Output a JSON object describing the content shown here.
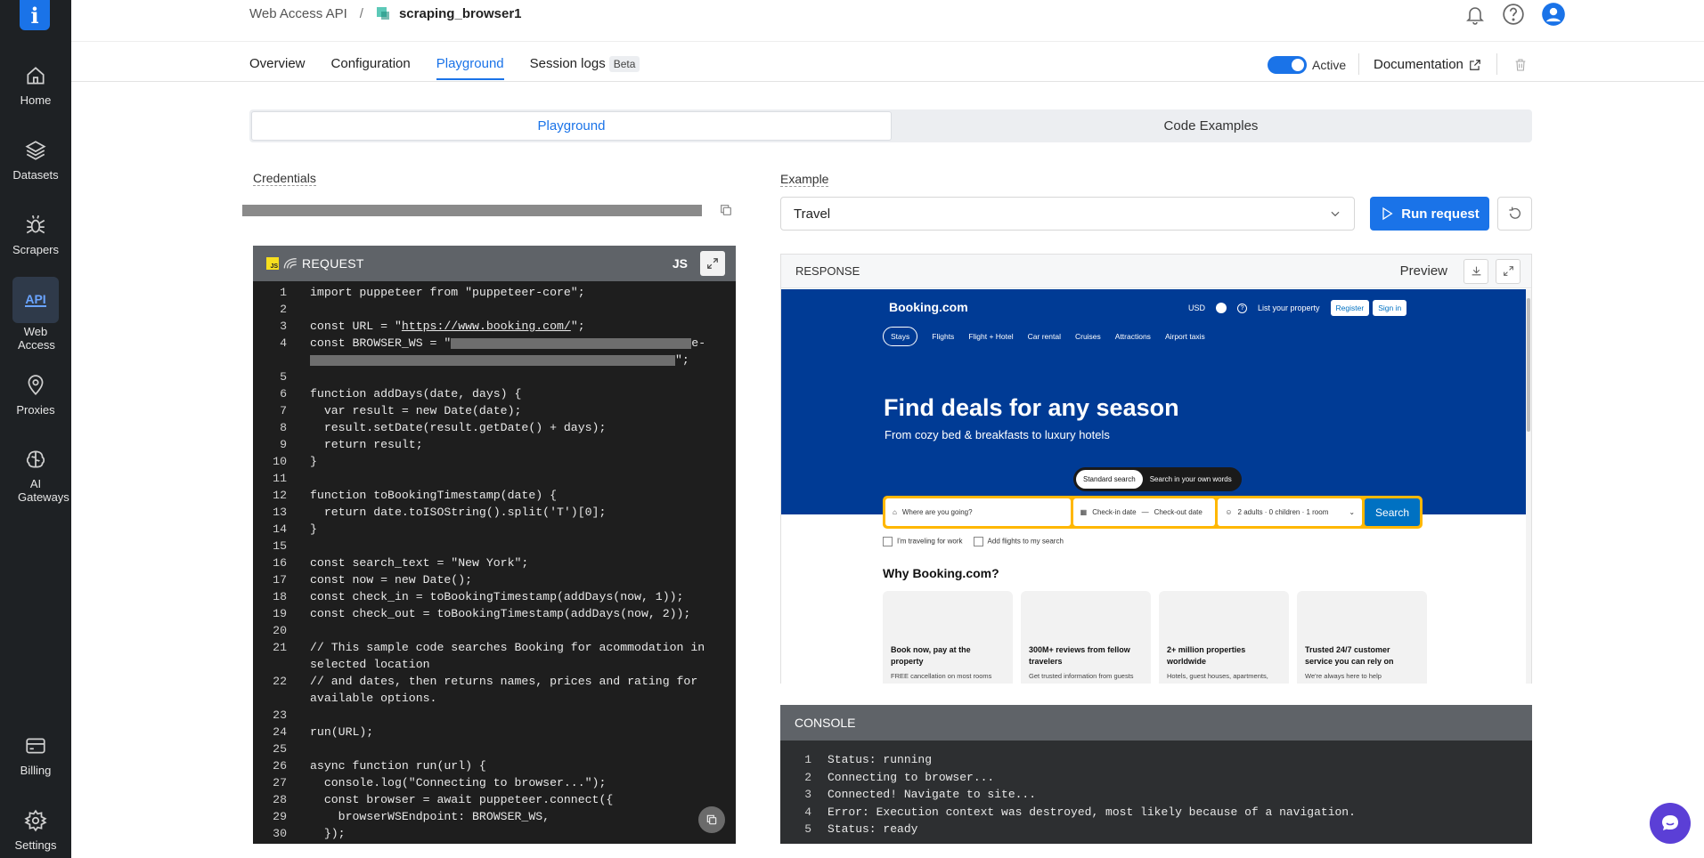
{
  "sidebar": {
    "logo": "i",
    "items": [
      {
        "label": "Home",
        "icon": "home-icon"
      },
      {
        "label": "Datasets",
        "icon": "datasets-icon"
      },
      {
        "label": "Scrapers",
        "icon": "scrapers-icon"
      },
      {
        "label": "Web Access",
        "icon": "api-icon",
        "icon_text": "API",
        "active": true
      },
      {
        "label": "Proxies",
        "icon": "proxies-icon"
      },
      {
        "label": "AI Gateways",
        "icon": "ai-gateways-icon"
      },
      {
        "label": "Billing",
        "icon": "billing-icon"
      },
      {
        "label": "Settings",
        "icon": "settings-icon"
      }
    ]
  },
  "header": {
    "breadcrumb_parent": "Web Access API",
    "breadcrumb_sep": "/",
    "breadcrumb_current": "scraping_browser1",
    "icons": [
      "bell-icon",
      "help-icon",
      "user-avatar-icon"
    ]
  },
  "tabs": [
    {
      "label": "Overview"
    },
    {
      "label": "Configuration"
    },
    {
      "label": "Playground",
      "active": true
    },
    {
      "label": "Session logs",
      "badge": "Beta"
    }
  ],
  "status": {
    "toggle_label": "Active",
    "toggle_on": true
  },
  "documentation_label": "Documentation",
  "segment": {
    "playground": "Playground",
    "code_examples": "Code Examples"
  },
  "credentials_label": "Credentials",
  "editor": {
    "title": "REQUEST",
    "lang": "JS",
    "badge": "JS",
    "lines": [
      {
        "n": "1",
        "t": "import puppeteer from \"puppeteer-core\";"
      },
      {
        "n": "2",
        "t": ""
      },
      {
        "n": "3",
        "t1": "const URL = \"",
        "link": "https://www.booking.com/",
        "t2": "\";"
      },
      {
        "n": "4",
        "t1": "const BROWSER_WS = \"",
        "t2": "e-"
      },
      {
        "n": "",
        "t2": "\";"
      },
      {
        "n": "5",
        "t": ""
      },
      {
        "n": "6",
        "t": "function addDays(date, days) {"
      },
      {
        "n": "7",
        "t": "  var result = new Date(date);"
      },
      {
        "n": "8",
        "t": "  result.setDate(result.getDate() + days);"
      },
      {
        "n": "9",
        "t": "  return result;"
      },
      {
        "n": "10",
        "t": "}"
      },
      {
        "n": "11",
        "t": ""
      },
      {
        "n": "12",
        "t": "function toBookingTimestamp(date) {"
      },
      {
        "n": "13",
        "t": "  return date.toISOString().split('T')[0];"
      },
      {
        "n": "14",
        "t": "}"
      },
      {
        "n": "15",
        "t": ""
      },
      {
        "n": "16",
        "t": "const search_text = \"New York\";"
      },
      {
        "n": "17",
        "t": "const now = new Date();"
      },
      {
        "n": "18",
        "t": "const check_in = toBookingTimestamp(addDays(now, 1));"
      },
      {
        "n": "19",
        "t": "const check_out = toBookingTimestamp(addDays(now, 2));"
      },
      {
        "n": "20",
        "t": ""
      },
      {
        "n": "21",
        "t": "// This sample code searches Booking for acommodation in"
      },
      {
        "n": "",
        "t": "selected location"
      },
      {
        "n": "22",
        "t": "// and dates, then returns names, prices and rating for"
      },
      {
        "n": "",
        "t": "available options."
      },
      {
        "n": "23",
        "t": ""
      },
      {
        "n": "24",
        "t": "run(URL);"
      },
      {
        "n": "25",
        "t": ""
      },
      {
        "n": "26",
        "t": "async function run(url) {"
      },
      {
        "n": "27",
        "t": "  console.log(\"Connecting to browser...\");"
      },
      {
        "n": "28",
        "t": "  const browser = await puppeteer.connect({"
      },
      {
        "n": "29",
        "t": "    browserWSEndpoint: BROWSER_WS,"
      },
      {
        "n": "30",
        "t": "  });"
      }
    ]
  },
  "example": {
    "label": "Example",
    "selected": "Travel"
  },
  "run_button": "Run request",
  "response": {
    "title": "RESPONSE",
    "preview_label": "Preview",
    "booking": {
      "logo": "Booking.com",
      "currency": "USD",
      "list_property": "List your property",
      "register": "Register",
      "sign_in": "Sign in",
      "nav": [
        "Stays",
        "Flights",
        "Flight + Hotel",
        "Car rental",
        "Cruises",
        "Attractions",
        "Airport taxis"
      ],
      "headline": "Find deals for any season",
      "subhead": "From cozy bed & breakfasts to luxury hotels",
      "pill_standard": "Standard search",
      "pill_words": "Search in your own words",
      "where_placeholder": "Where are you going?",
      "checkin": "Check-in date",
      "checkout": "Check-out date",
      "guests": "2 adults · 0 children · 1 room",
      "search": "Search",
      "check_work": "I'm traveling for work",
      "check_flights": "Add flights to my search",
      "why": "Why Booking.com?",
      "cards": [
        {
          "title": "Book now, pay at the property",
          "text": "FREE cancellation on most rooms"
        },
        {
          "title": "300M+ reviews from fellow travelers",
          "text": "Get trusted information from guests"
        },
        {
          "title": "2+ million properties worldwide",
          "text": "Hotels, guest houses, apartments,"
        },
        {
          "title": "Trusted 24/7 customer service you can rely on",
          "text": "We're always here to help"
        }
      ]
    }
  },
  "console": {
    "title": "CONSOLE",
    "lines": [
      {
        "n": "1",
        "t": "Status: running"
      },
      {
        "n": "2",
        "t": "Connecting to browser..."
      },
      {
        "n": "3",
        "t": "Connected! Navigate to site..."
      },
      {
        "n": "4",
        "t": "Error: Execution context was destroyed, most likely because of a navigation."
      },
      {
        "n": "5",
        "t": "Status: ready"
      }
    ]
  },
  "colors": {
    "accent": "#1a73e8",
    "sidebar_bg": "#1e2124",
    "booking_blue": "#003b95",
    "booking_yellow": "#ffb700"
  }
}
